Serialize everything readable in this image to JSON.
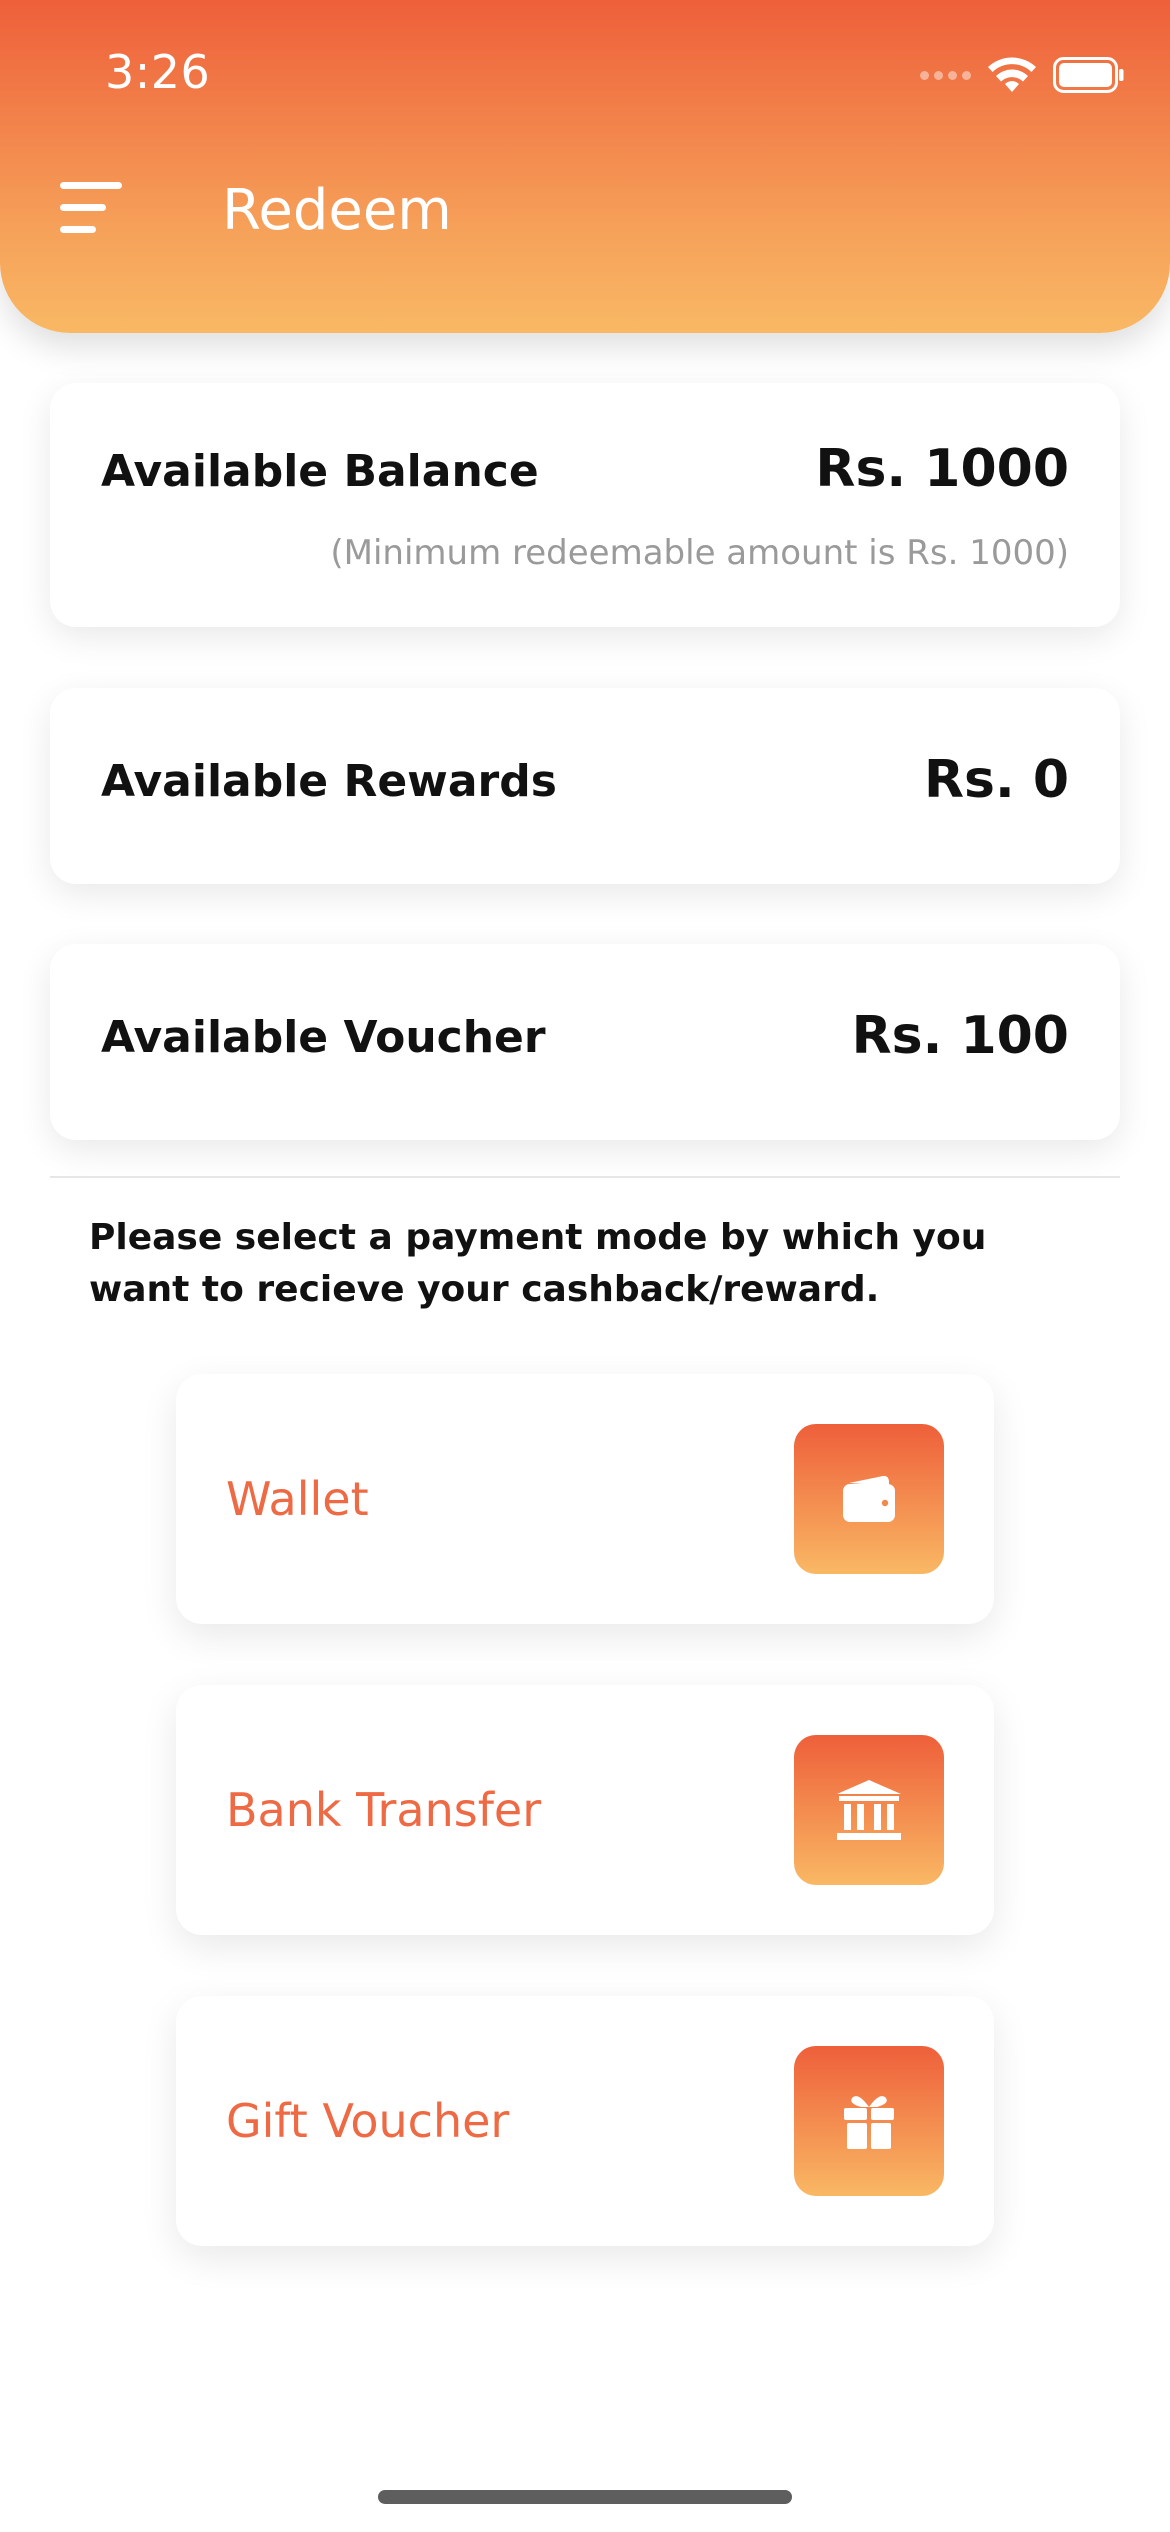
{
  "status_bar": {
    "time": "3:26"
  },
  "header": {
    "title": "Redeem"
  },
  "balances": [
    {
      "label": "Available Balance",
      "value": "Rs. 1000",
      "note": "(Minimum redeemable amount is Rs. 1000)"
    },
    {
      "label": "Available Rewards",
      "value": "Rs. 0"
    },
    {
      "label": "Available Voucher",
      "value": "Rs. 100"
    }
  ],
  "instruction": "Please select a payment mode by which you want to recieve your cashback/reward.",
  "payment_modes": [
    {
      "label": "Wallet",
      "icon": "wallet-icon"
    },
    {
      "label": "Bank Transfer",
      "icon": "bank-icon"
    },
    {
      "label": "Gift Voucher",
      "icon": "gift-icon"
    }
  ],
  "colors": {
    "gradient_top": "#ee5f3a",
    "gradient_bottom": "#f9b864",
    "accent_text": "#ee6a44",
    "primary_text": "#111111",
    "muted_text": "#9a9a9a"
  }
}
